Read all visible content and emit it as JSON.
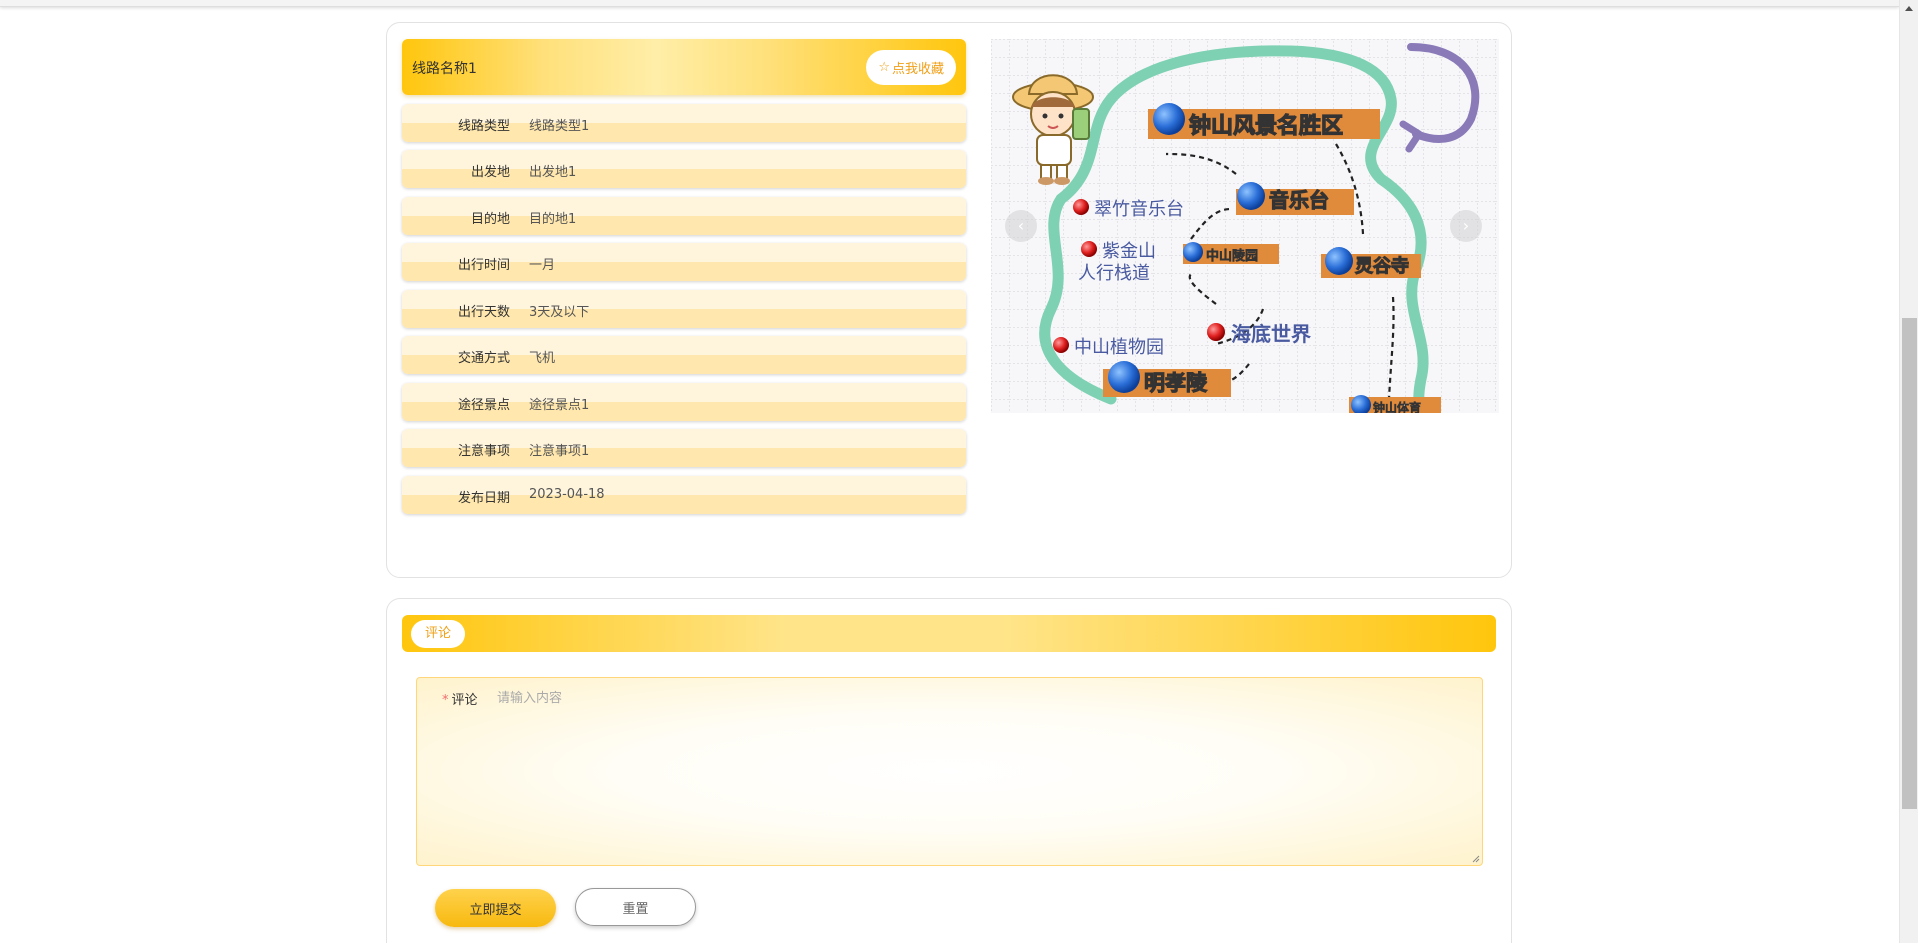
{
  "route": {
    "name": "线路名称1",
    "favorite_label": "点我收藏",
    "favorite_icon": "star-outline-icon",
    "fields": [
      {
        "label": "线路类型",
        "value": "线路类型1"
      },
      {
        "label": "出发地",
        "value": "出发地1"
      },
      {
        "label": "目的地",
        "value": "目的地1"
      },
      {
        "label": "出行时间",
        "value": "一月"
      },
      {
        "label": "出行天数",
        "value": "3天及以下"
      },
      {
        "label": "交通方式",
        "value": "飞机"
      },
      {
        "label": "途径景点",
        "value": "途径景点1"
      },
      {
        "label": "注意事项",
        "value": "注意事项1"
      },
      {
        "label": "发布日期",
        "value": "2023-04-18"
      }
    ]
  },
  "map_image": {
    "labels": {
      "zhongshan": "钟山风景名胜区",
      "yinyuetai": "音乐台",
      "cuizhu": "翠竹音乐台",
      "zijinshan": "紫金山",
      "zhandao": "人行栈道",
      "zhongshanling": "中山陵园",
      "linggu": "灵谷寺",
      "zhiwuyuan": "中山植物园",
      "haidi": "海底世界",
      "mingxiaoling": "明孝陵",
      "tiyu": "钟山体育"
    },
    "colors": {
      "outline": "#7fd1b3",
      "arrow": "#8a7ab8",
      "banner": "#e08a3c"
    }
  },
  "comment": {
    "tab_label": "评论",
    "field_label": "评论",
    "placeholder": "请输入内容",
    "value": "",
    "submit_label": "立即提交",
    "reset_label": "重置"
  },
  "theme": {
    "accent": "#ffc60d",
    "accent_text": "#f0a018"
  }
}
